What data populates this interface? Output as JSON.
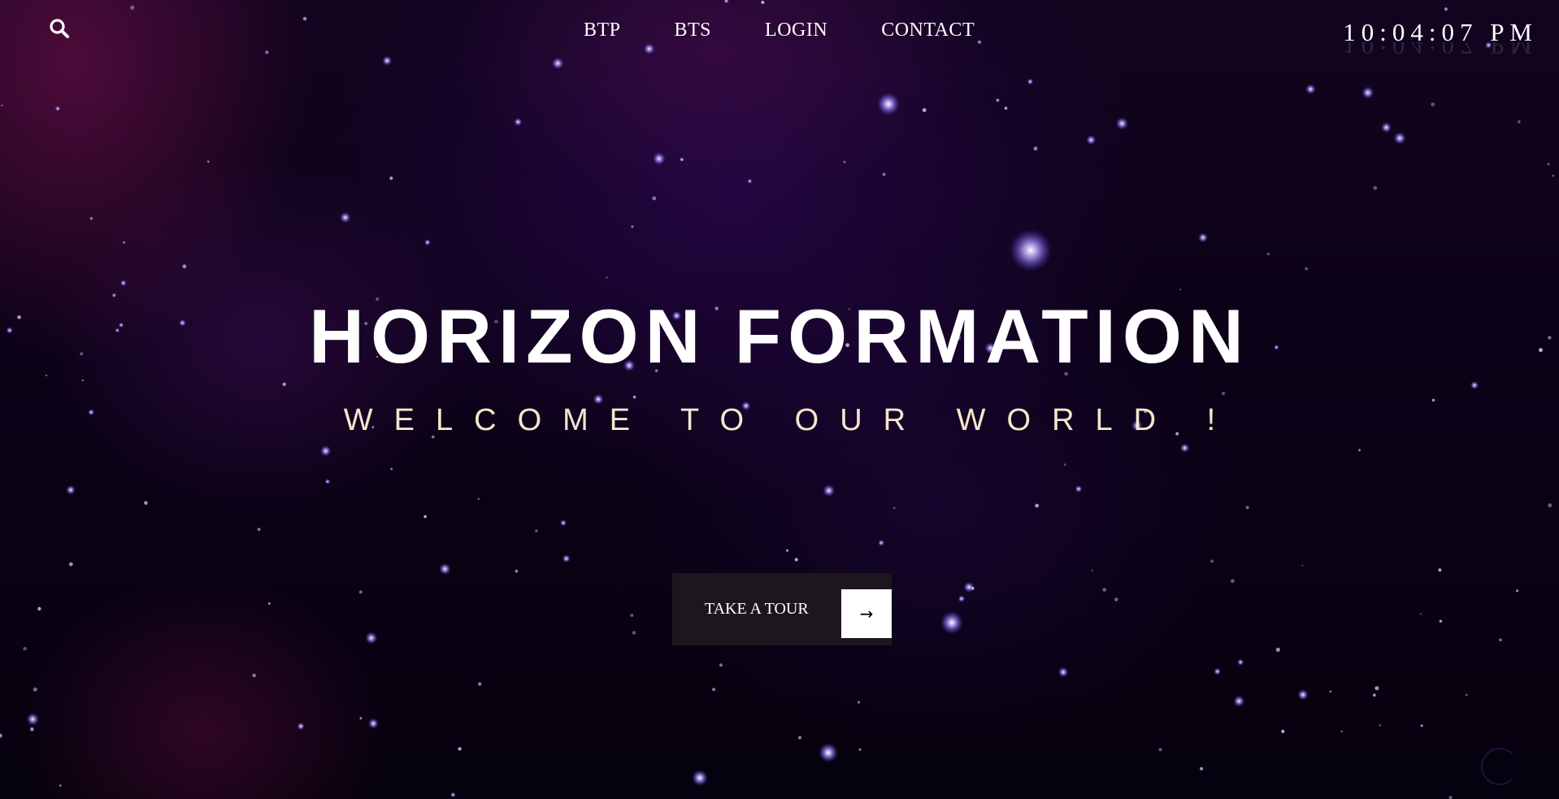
{
  "header": {
    "search_icon": "search-icon",
    "nav": [
      {
        "label": "BTP"
      },
      {
        "label": "BTS"
      },
      {
        "label": "LOGIN"
      },
      {
        "label": "CONTACT"
      }
    ],
    "clock": "10:04:07 PM"
  },
  "hero": {
    "title": "HORIZON FORMATION",
    "subtitle": "WELCOME TO OUR WORLD !",
    "cta_label": "TAKE A TOUR",
    "cta_icon": "arrow-right-icon"
  },
  "colors": {
    "background": "#0b0217",
    "title": "#ffffff",
    "subtitle": "#f5e6cc",
    "cta_background": "#1b171d",
    "cta_arrow_box": "#ffffff",
    "star": "#c9b8ff"
  }
}
